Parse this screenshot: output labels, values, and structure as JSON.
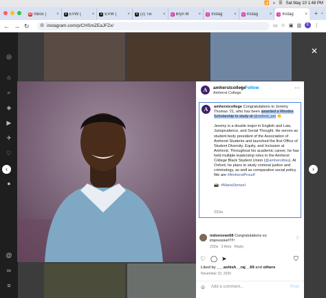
{
  "menubar": {
    "date_time": "Sat May 10  1:48 PM"
  },
  "tabs": [
    {
      "title": "Inbox (",
      "fav": "M",
      "color": "#d93025",
      "active": false
    },
    {
      "title": "EVW (",
      "fav": "X",
      "color": "#111111",
      "active": false
    },
    {
      "title": "EVW (",
      "fav": "X",
      "color": "#111111",
      "active": false
    },
    {
      "title": "(2) Tw",
      "fav": "X",
      "color": "#111111",
      "active": false
    },
    {
      "title": "Bryn M",
      "fav": "◎",
      "color": "#d6249f",
      "active": false
    },
    {
      "title": "Instag",
      "fav": "◎",
      "color": "#d6249f",
      "active": false
    },
    {
      "title": "Instag",
      "fav": "◎",
      "color": "#d6249f",
      "active": false
    },
    {
      "title": "Instag",
      "fav": "◎",
      "color": "#d6249f",
      "active": true
    }
  ],
  "toolbar": {
    "url": "instagram.com/p/CHSmZEaJFZx/",
    "profile_initial": "E"
  },
  "post": {
    "username": "amherstcollege",
    "dot": "•",
    "follow": "Follow",
    "location": "Amherst College",
    "caption_username": "amherstcollege",
    "caption_1": " Congratulations to Jeremy Thomas '21, who has been ",
    "caption_hl": "awarded a Rhodes Scholarship to study at ",
    "caption_mention": "@oxford_uni",
    "caption_emoji": " 👏",
    "caption_2": "Jeremy is a double major in English and Law, Jurisprudence, and Social Thought. He serves as student body president of the Association of Amherst Students and launched the first Office of Student Diversity, Equity, and Inclusion at Amherst. Throughout his academic career, he has held multiple leadership roles in the Amherst College Black Student Union (",
    "caption_mention2": "@amherstbsu",
    "caption_3": "). At Oxford, he plans to study criminal justice and criminology, as well as comparative social policy. We are ",
    "caption_tag": "#AmherstProud",
    "caption_4": "!",
    "caption_photo_credit": "📸: ",
    "caption_credit_tag": "#MariaStenzel",
    "caption_time": "232w",
    "comment_user": "mdonovan68",
    "comment_text": " Congratulations so impressive!!!!!!",
    "comment_time": "232w",
    "comment_likes": "2 likes",
    "comment_reply": "Reply",
    "likes_prefix": "Liked by ",
    "likes_user": "___ashish__raj__69",
    "likes_suffix": " and ",
    "likes_others": "others",
    "date": "November 22, 2020",
    "add_comment": "Add a comment...",
    "post_button": "Post"
  },
  "colors": {
    "instagram_blue": "#0095f6",
    "amherst_purple": "#3f1f69",
    "highlight": "#b4cff4"
  }
}
